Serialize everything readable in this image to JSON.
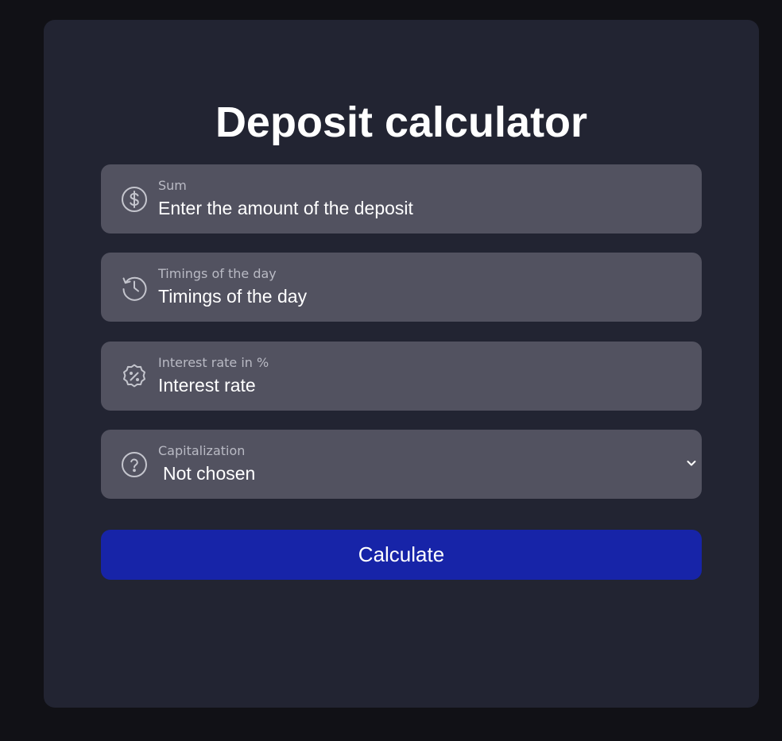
{
  "title": "Deposit calculator",
  "fields": {
    "sum": {
      "label": "Sum",
      "placeholder": "Enter the amount of the deposit",
      "icon": "dollar-circle-icon"
    },
    "timings": {
      "label": "Timings of the day",
      "placeholder": "Timings of the day",
      "icon": "history-icon"
    },
    "interest": {
      "label": "Interest rate in %",
      "placeholder": "Interest rate",
      "icon": "percent-badge-icon"
    },
    "capitalization": {
      "label": "Capitalization",
      "selected": "Not chosen",
      "icon": "question-circle-icon",
      "dropdown_icon": "chevron-down-icon"
    }
  },
  "button": {
    "label": "Calculate"
  },
  "colors": {
    "page_background": "#111116",
    "card_background": "#222432",
    "field_background": "#525260",
    "button_background": "#1724a8",
    "label_color": "#b9bac4",
    "text_color": "#ffffff"
  }
}
